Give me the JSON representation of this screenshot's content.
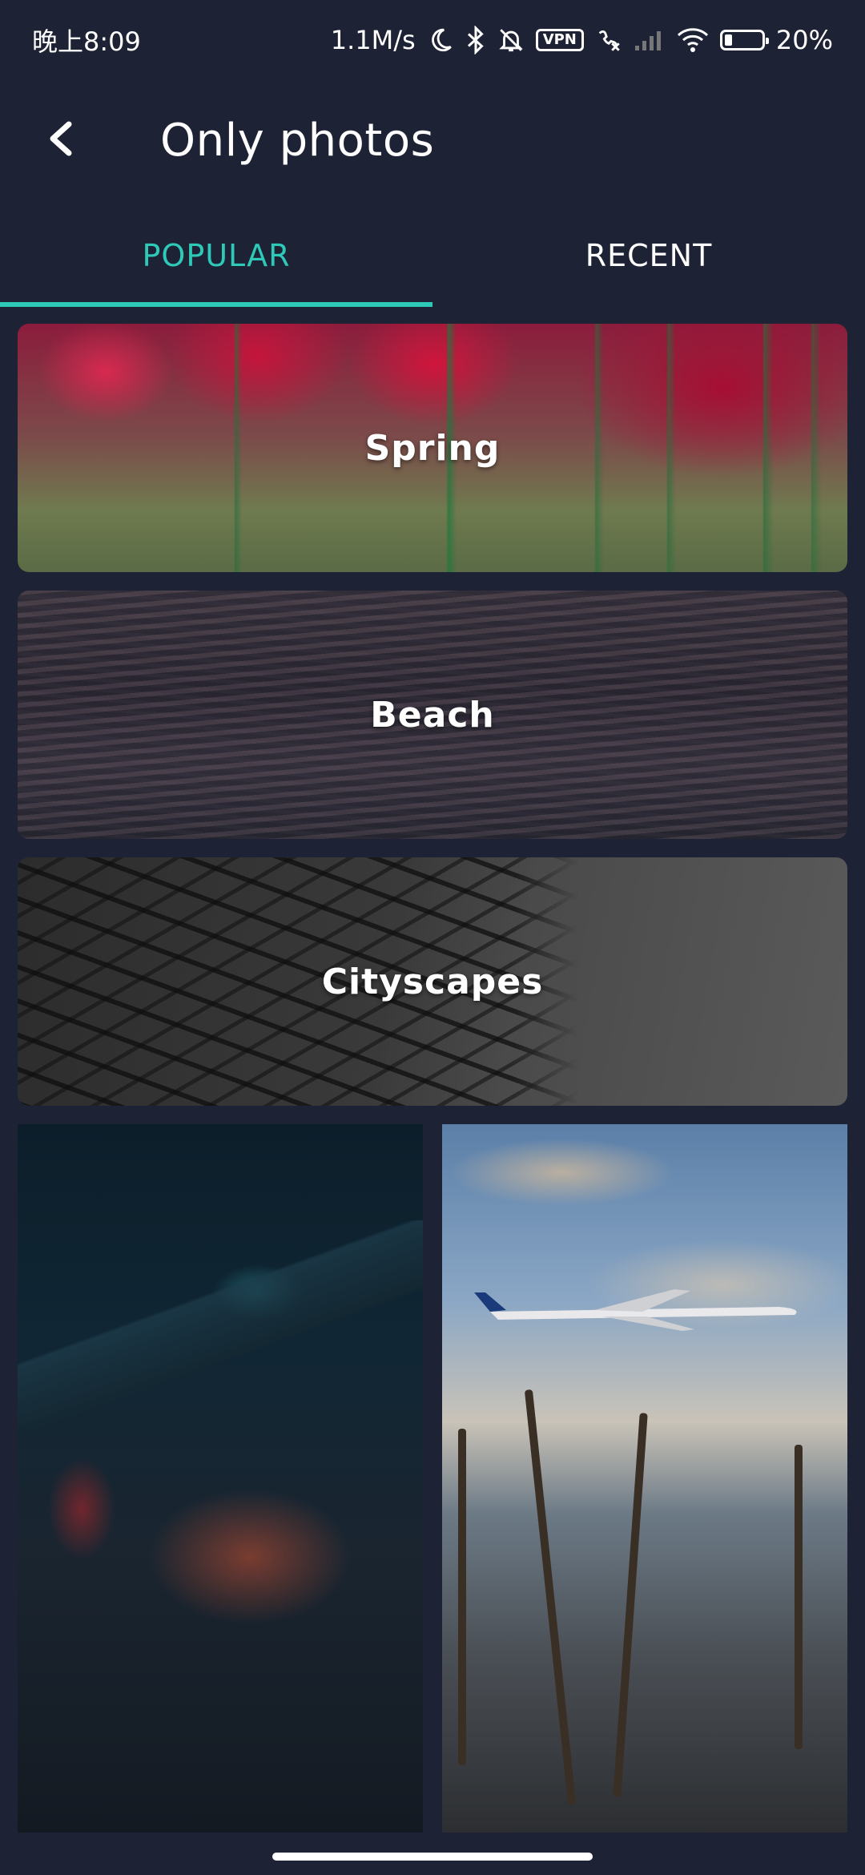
{
  "status_bar": {
    "time": "晚上8:09",
    "net_speed": "1.1M/s",
    "vpn_label": "VPN",
    "battery_percent": "20%",
    "battery_level": 0.2
  },
  "header": {
    "title": "Only photos"
  },
  "tabs": [
    {
      "label": "POPULAR",
      "active": true
    },
    {
      "label": "RECENT",
      "active": false
    }
  ],
  "collections": [
    {
      "label": "Spring"
    },
    {
      "label": "Beach"
    },
    {
      "label": "Cityscapes"
    }
  ],
  "colors": {
    "background": "#1e2235",
    "accent": "#2ec9b7",
    "text": "#ffffff"
  }
}
